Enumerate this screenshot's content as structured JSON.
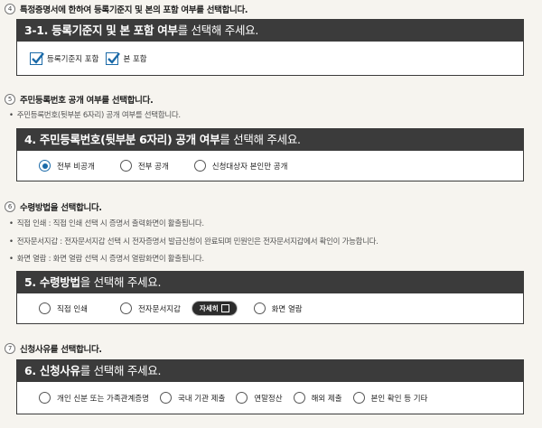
{
  "step4": {
    "num": "4",
    "title": "특정증명서에 한하여 등록기준지 및 본의 포함 여부를 선택합니다.",
    "panel_bold": "3-1. 등록기준지 및 본 포함 여부",
    "panel_rest": "를 선택해 주세요.",
    "options": [
      {
        "label": "등록기준지 포함",
        "checked": true
      },
      {
        "label": "본 포함",
        "checked": true
      }
    ]
  },
  "step5": {
    "num": "5",
    "title": "주민등록번호 공개 여부를 선택합니다.",
    "bullet": "주민등록번호(뒷부분 6자리) 공개 여부를 선택합니다.",
    "panel_bold": "4. 주민등록번호(뒷부분 6자리) 공개 여부",
    "panel_rest": "를 선택해 주세요.",
    "options": [
      {
        "label": "전부 비공개",
        "selected": true
      },
      {
        "label": "전부 공개",
        "selected": false
      },
      {
        "label": "신청대상자 본인만 공개",
        "selected": false
      }
    ]
  },
  "step6": {
    "num": "6",
    "title": "수령방법을 선택합니다.",
    "bullets": [
      "직접 인쇄 : 직접 인쇄 선택 시 증명서 출력화면이 활출됩니다.",
      "전자문서지갑 : 전자문서지갑 선택 시 전자증명서 발급신청이 완료되며 민원인은 전자문서지갑에서 확인이 가능합니다.",
      "화면 열람 : 화면 열람 선택 시 증명서 열람화면이 활출됩니다."
    ],
    "panel_bold": "5. 수령방법",
    "panel_rest": "을 선택해 주세요.",
    "options": [
      {
        "label": "직접 인쇄",
        "selected": false
      },
      {
        "label": "전자문서지갑",
        "selected": false
      },
      {
        "label": "화면 열람",
        "selected": false
      }
    ],
    "detail_button": "자세히"
  },
  "step7": {
    "num": "7",
    "title": "신청사유를 선택합니다.",
    "panel_bold": "6. 신청사유",
    "panel_rest": "를 선택해 주세요.",
    "options": [
      {
        "label": "개인 신분 또는 가족관계증명",
        "selected": false
      },
      {
        "label": "국내 기관 제출",
        "selected": false
      },
      {
        "label": "연말정산",
        "selected": false
      },
      {
        "label": "해외 제출",
        "selected": false
      },
      {
        "label": "본인 확인 등 기타",
        "selected": false
      }
    ]
  },
  "colors": {
    "accent": "#1b6aa8",
    "panel_header": "#3b3b3b"
  }
}
